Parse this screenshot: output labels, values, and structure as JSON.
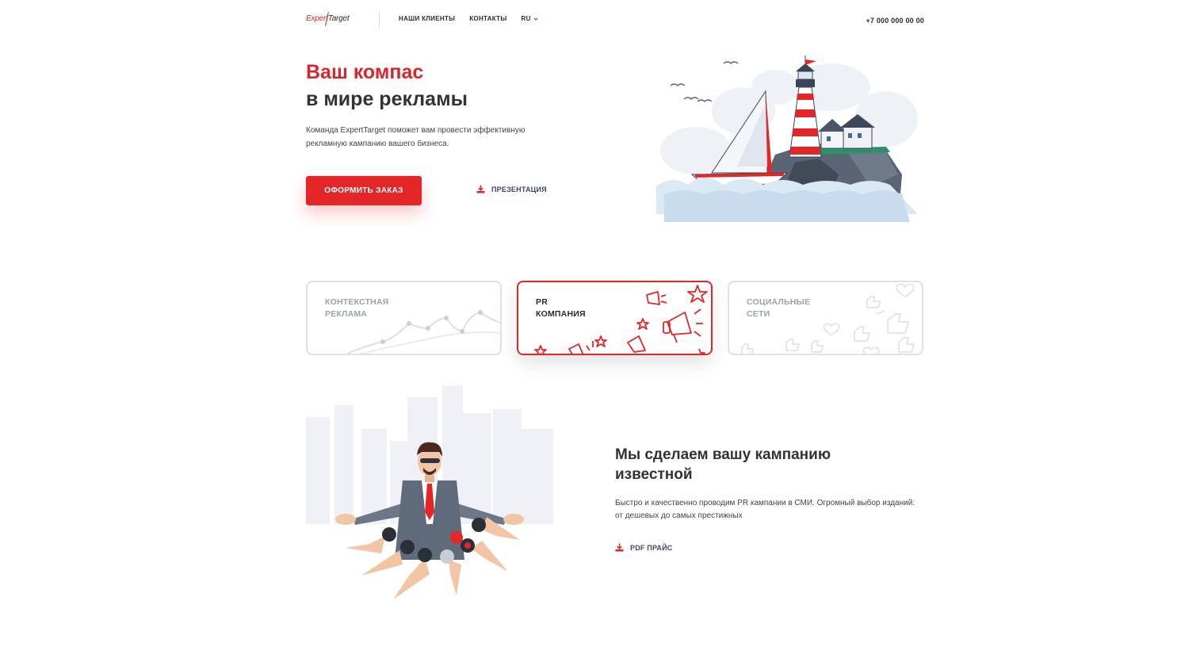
{
  "header": {
    "logo_text_1": "Expert",
    "logo_text_2": "Target",
    "nav": [
      "НАШИ КЛИЕНТЫ",
      "КОНТАКТЫ"
    ],
    "lang": "RU",
    "phone": "+7 000 000 00 00"
  },
  "hero": {
    "title_line1": "Ваш компас",
    "title_line2": "в мире рекламы",
    "description": "Команда ExpertTarget поможет вам провести эффективную рекламную кампанию вашего бизнеса.",
    "order_button": "ОФОРМИТЬ ЗАКАЗ",
    "presentation_link": "ПРЕЗЕНТАЦИЯ"
  },
  "services": [
    {
      "line1": "КОНТЕКСТНАЯ",
      "line2": "РЕКЛАМА",
      "active": false
    },
    {
      "line1": "PR",
      "line2": "КОМПАНИЯ",
      "active": true
    },
    {
      "line1": "СОЦИАЛЬНЫЕ",
      "line2": "СЕТИ",
      "active": false
    }
  ],
  "pr_section": {
    "title": "Мы сделаем вашу кампанию известной",
    "description": "Быстро и качественно проводим PR кампании в СМИ. Огромный выбор изданий: от дешевых до самых престижных",
    "pdf_link": "PDF ПРАЙС"
  },
  "colors": {
    "accent": "#e52629",
    "heading": "#333333",
    "link": "#3a4a63",
    "card_border": "#dde1e8"
  },
  "icons": [
    "download-icon",
    "chevron-down-icon"
  ]
}
